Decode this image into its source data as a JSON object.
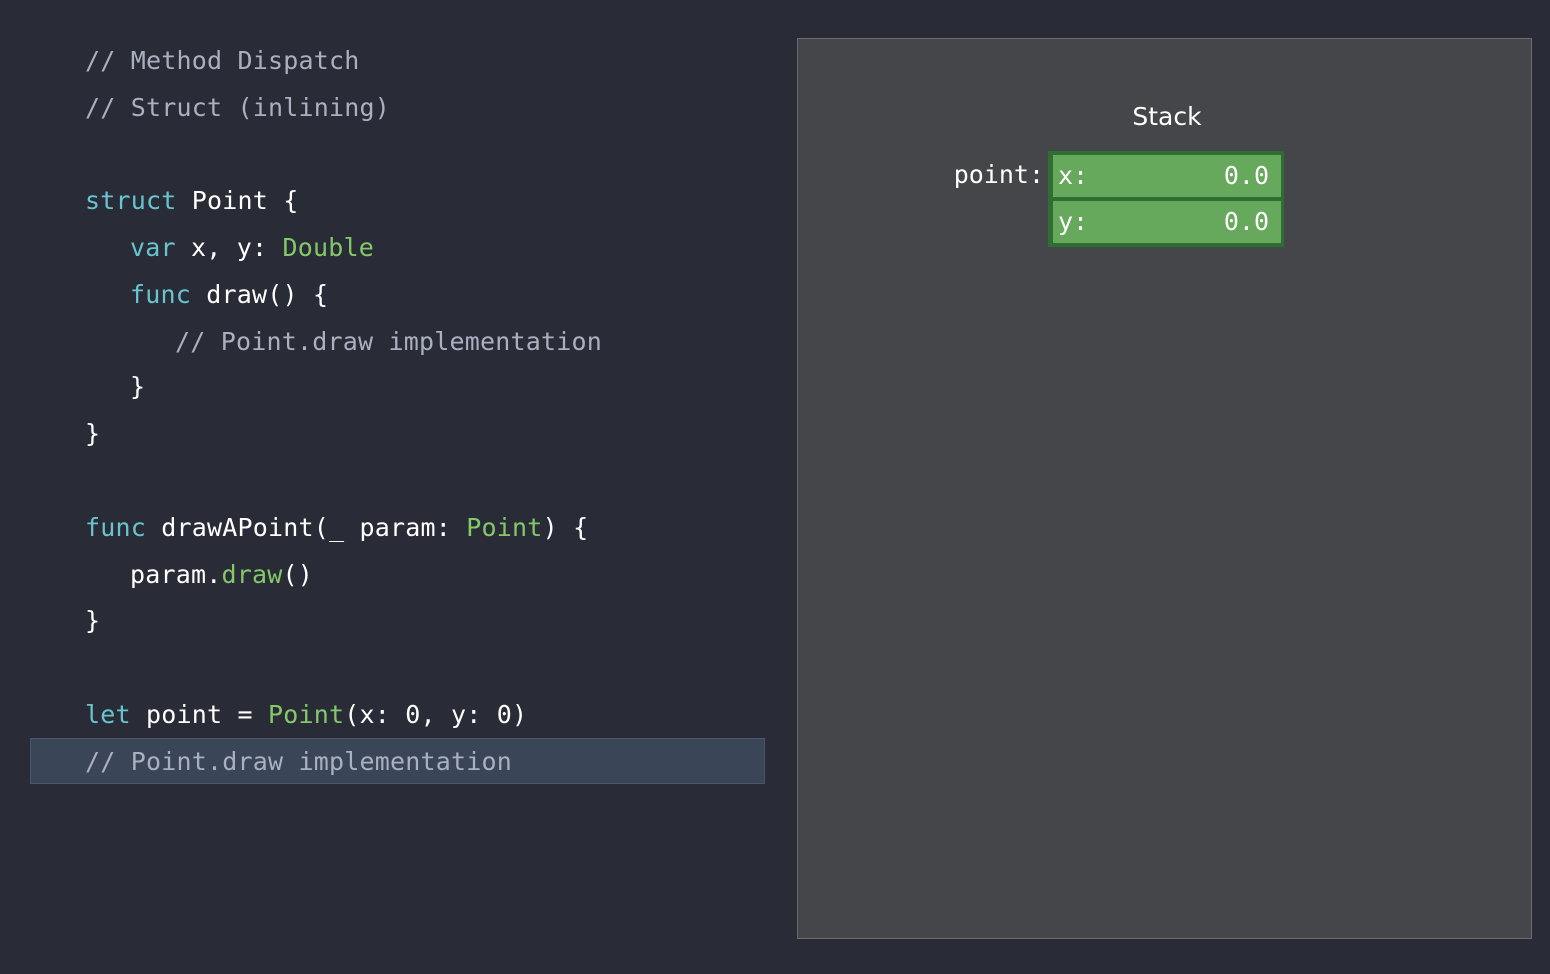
{
  "code": {
    "lines": [
      [
        "// Method Dispatch"
      ],
      [
        "// Struct (inlining)"
      ],
      [
        "struct",
        " Point {"
      ],
      [
        "var",
        " x, y: ",
        "Double"
      ],
      [
        "func",
        " draw() {"
      ],
      [
        "// Point.draw implementation"
      ],
      [
        "}"
      ],
      [
        "}"
      ],
      [
        "func",
        " drawAPoint(_ param: ",
        "Point",
        ") {"
      ],
      [
        "param.",
        "draw",
        "()"
      ],
      [
        "}"
      ],
      [
        "let",
        " point = ",
        "Point",
        "(x: 0, y: 0)"
      ],
      [
        "// Point.draw implementation"
      ]
    ]
  },
  "stack": {
    "title": "Stack",
    "variable": "point:",
    "fields": [
      {
        "name": "x:",
        "value": "0.0"
      },
      {
        "name": "y:",
        "value": "0.0"
      }
    ]
  },
  "colors": {
    "background": "#292c37",
    "comment": "#aab0bf",
    "keyword": "#68c4cf",
    "type": "#84c86a",
    "text": "#ffffff",
    "highlight": "#3a4558",
    "panel": "#454649",
    "field_fill": "#67a95c",
    "field_border": "#2e6e32"
  }
}
